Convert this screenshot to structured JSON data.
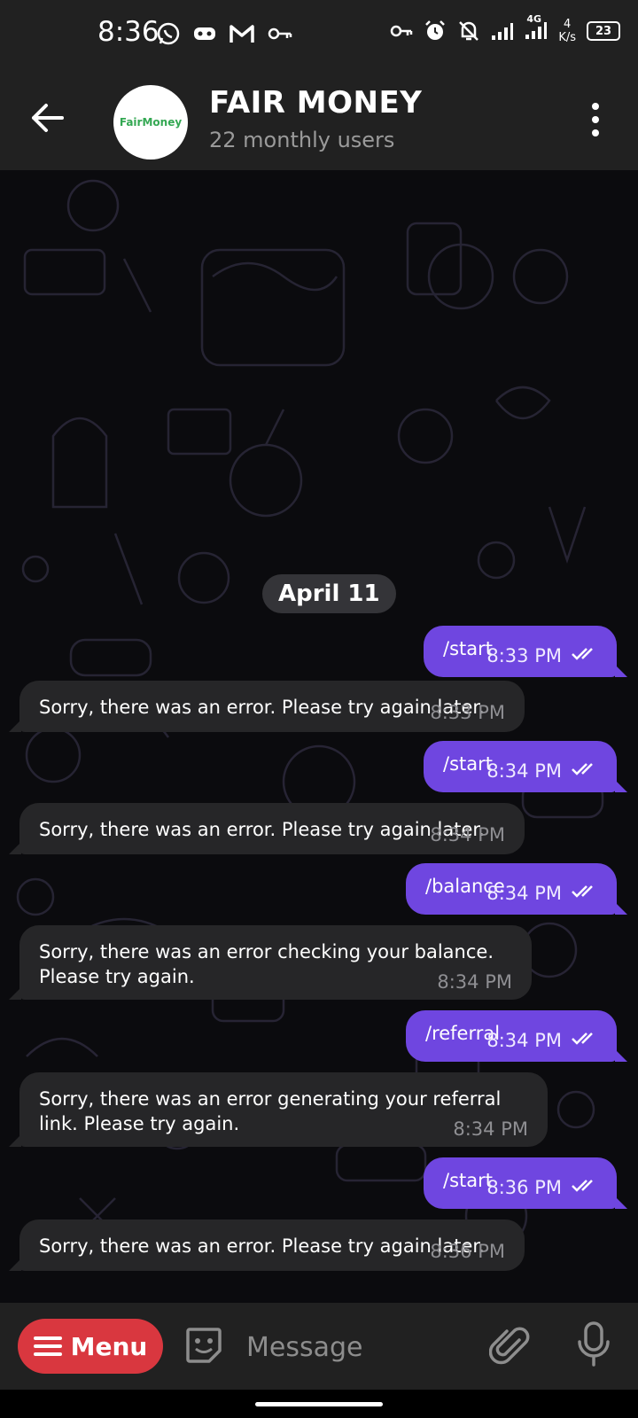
{
  "status_bar": {
    "time": "8:36",
    "net_speed_top": "4",
    "net_speed_bottom": "K/s",
    "network": "4G",
    "battery": "23",
    "left_icons": [
      "whatsapp-icon",
      "game-icon",
      "gmail-icon",
      "key-icon"
    ],
    "right_icons": [
      "vpn-key-icon",
      "alarm-icon",
      "mute-icon",
      "signal-icon",
      "signal-4g-icon"
    ]
  },
  "header": {
    "title": "FAIR MONEY",
    "subtitle": "22 monthly users",
    "avatar_text": "FairMoney"
  },
  "chat": {
    "date_label": "April 11",
    "messages": [
      {
        "dir": "out",
        "text": "/start",
        "time": "8:33 PM"
      },
      {
        "dir": "in",
        "text": "Sorry, there was an error. Please try again later.",
        "time": "8:33 PM"
      },
      {
        "dir": "out",
        "text": "/start",
        "time": "8:34 PM"
      },
      {
        "dir": "in",
        "text": "Sorry, there was an error. Please try again later.",
        "time": "8:34 PM"
      },
      {
        "dir": "out",
        "text": "/balance",
        "time": "8:34 PM"
      },
      {
        "dir": "in",
        "text": "Sorry, there was an error checking your balance. Please try again.",
        "time": "8:34 PM"
      },
      {
        "dir": "out",
        "text": "/referral",
        "time": "8:34 PM"
      },
      {
        "dir": "in",
        "text": "Sorry, there was an error generating your referral link. Please try again.",
        "time": "8:34 PM"
      },
      {
        "dir": "out",
        "text": "/start",
        "time": "8:36 PM"
      },
      {
        "dir": "in",
        "text": "Sorry, there was an error. Please try again later.",
        "time": "8:36 PM"
      }
    ]
  },
  "input_bar": {
    "menu_label": "Menu",
    "placeholder": "Message"
  },
  "colors": {
    "outgoing_bubble": "#6f46e0",
    "incoming_bubble": "#262628",
    "menu_button": "#d9373f",
    "bar_background": "#212121"
  }
}
